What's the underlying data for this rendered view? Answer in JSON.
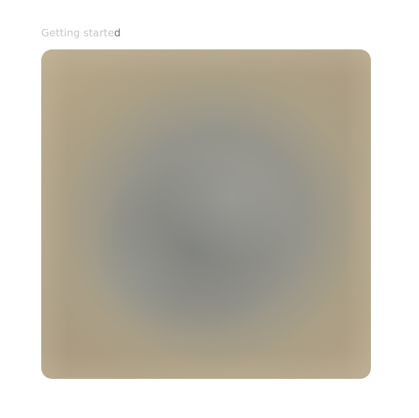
{
  "header": {
    "title_faded": "Getting starte",
    "title_tail": "d"
  },
  "media": {
    "type": "blurred-image-placeholder"
  }
}
